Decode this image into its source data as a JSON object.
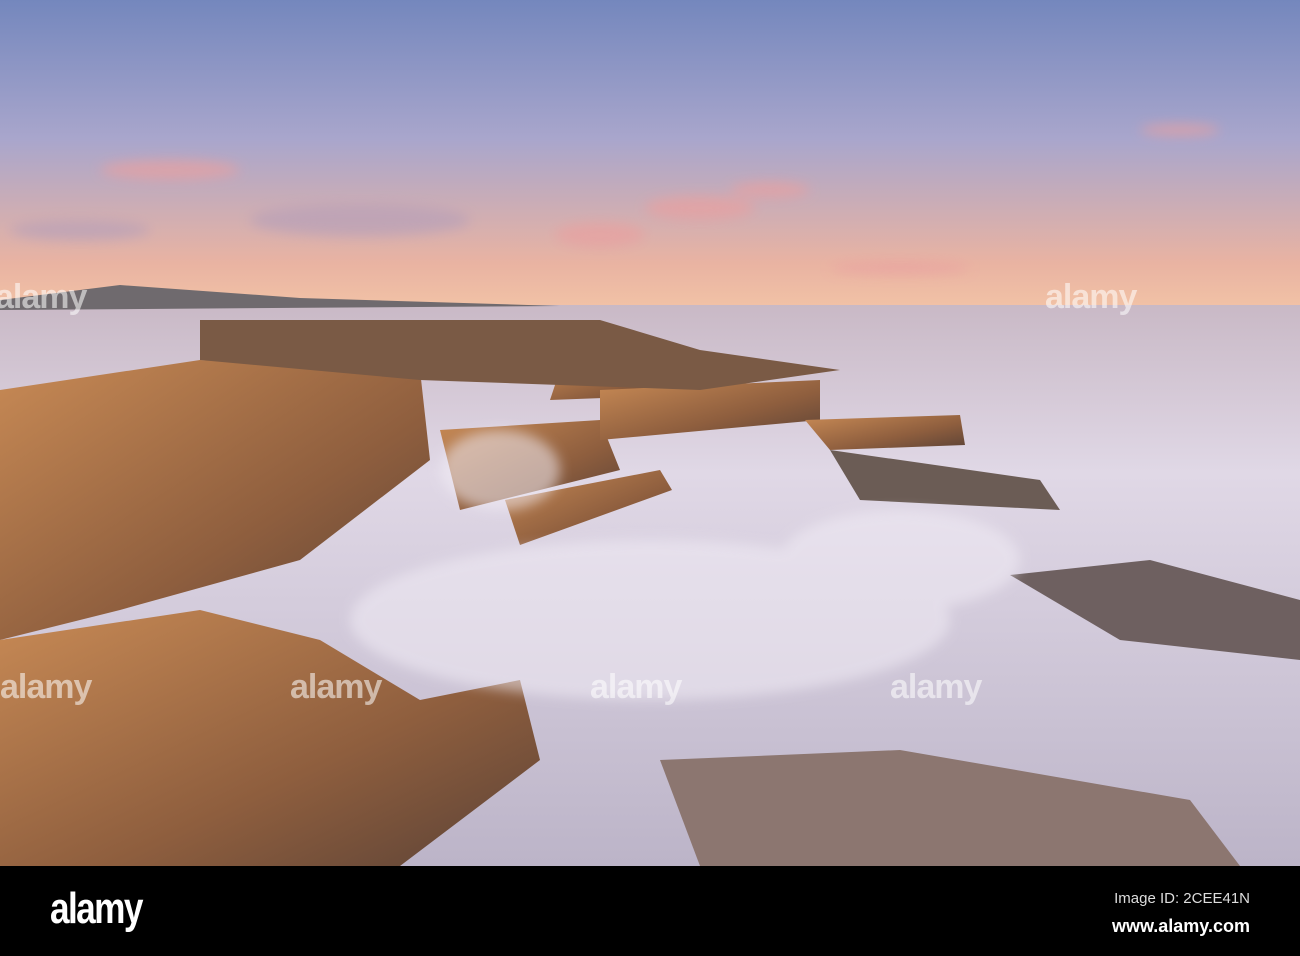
{
  "watermark": {
    "logo_text": "alamy",
    "image_id": "Image ID: 2CEE41N",
    "url": "www.alamy.com"
  },
  "colors": {
    "sky_top": "#7f93c4",
    "sky_horizon": "#f0b49a",
    "water": "#d9d4e6",
    "rock": "#b67a4c"
  }
}
